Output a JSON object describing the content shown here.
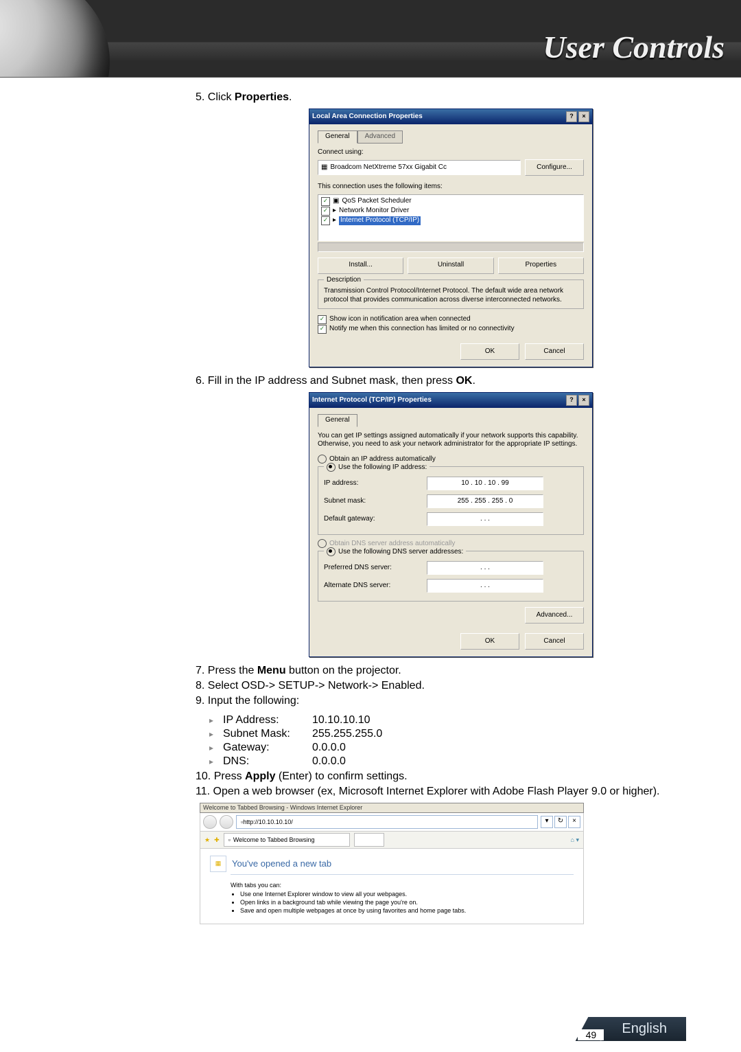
{
  "header": {
    "title": "User Controls"
  },
  "step5": {
    "prefix": "5. Click ",
    "bold": "Properties",
    "suffix": "."
  },
  "dlg1": {
    "title": "Local Area Connection Properties",
    "help": "?",
    "close": "×",
    "tab_general": "General",
    "tab_advanced": "Advanced",
    "connect_using": "Connect using:",
    "adapter": "Broadcom NetXtreme 57xx Gigabit Cc",
    "configure": "Configure...",
    "uses_label": "This connection uses the following items:",
    "item1": "QoS Packet Scheduler",
    "item2": "Network Monitor Driver",
    "item3": "Internet Protocol (TCP/IP)",
    "install": "Install...",
    "uninstall": "Uninstall",
    "properties": "Properties",
    "desc_label": "Description",
    "desc_text": "Transmission Control Protocol/Internet Protocol. The default wide area network protocol that provides communication across diverse interconnected networks.",
    "cb1": "Show icon in notification area when connected",
    "cb2": "Notify me when this connection has limited or no connectivity",
    "ok": "OK",
    "cancel": "Cancel"
  },
  "step6": {
    "prefix": "6. Fill in the IP address and Subnet mask, then press ",
    "bold": "OK",
    "suffix": "."
  },
  "dlg2": {
    "title": "Internet Protocol (TCP/IP) Properties",
    "tab_general": "General",
    "intro": "You can get IP settings assigned automatically if your network supports this capability. Otherwise, you need to ask your network administrator for the appropriate IP settings.",
    "r_auto": "Obtain an IP address automatically",
    "r_use": "Use the following IP address:",
    "ip_label": "IP address:",
    "ip_val": "10 . 10 . 10 . 99",
    "mask_label": "Subnet mask:",
    "mask_val": "255 . 255 . 255 . 0",
    "gw_label": "Default gateway:",
    "gw_val": ".     .     .",
    "r_dns_auto": "Obtain DNS server address automatically",
    "r_dns_use": "Use the following DNS server addresses:",
    "pdns": "Preferred DNS server:",
    "adns": "Alternate DNS server:",
    "dns_blank": ".     .     .",
    "advanced": "Advanced...",
    "ok": "OK",
    "cancel": "Cancel"
  },
  "step7": {
    "prefix": "7. Press the ",
    "bold": "Menu",
    "suffix": " button on the projector."
  },
  "step8": "8. Select OSD-> SETUP-> Network-> Enabled.",
  "step9": "9. Input the following:",
  "net": {
    "ip_k": "IP Address:",
    "ip_v": "10.10.10.10",
    "mask_k": "Subnet Mask:",
    "mask_v": "255.255.255.0",
    "gw_k": "Gateway:",
    "gw_v": "0.0.0.0",
    "dns_k": "DNS:",
    "dns_v": "0.0.0.0"
  },
  "step10": {
    "prefix": "10. Press ",
    "bold": "Apply",
    "suffix": " (Enter) to confirm settings."
  },
  "step11": "11. Open a web browser (ex, Microsoft Internet Explorer with Adobe Flash Player 9.0 or higher).",
  "ie": {
    "title": "Welcome to Tabbed Browsing - Windows Internet Explorer",
    "url": "http://10.10.10.10/",
    "x": "×",
    "tab_name": "Welcome to Tabbed Browsing",
    "new_tab": "You've opened a new tab",
    "can": "With tabs you can:",
    "b1": "Use one Internet Explorer window to view all your webpages.",
    "b2": "Open links in a background tab while viewing the page you're on.",
    "b3": "Save and open multiple webpages at once by using favorites and home page tabs."
  },
  "footer": {
    "page": "49",
    "lang": "English"
  }
}
